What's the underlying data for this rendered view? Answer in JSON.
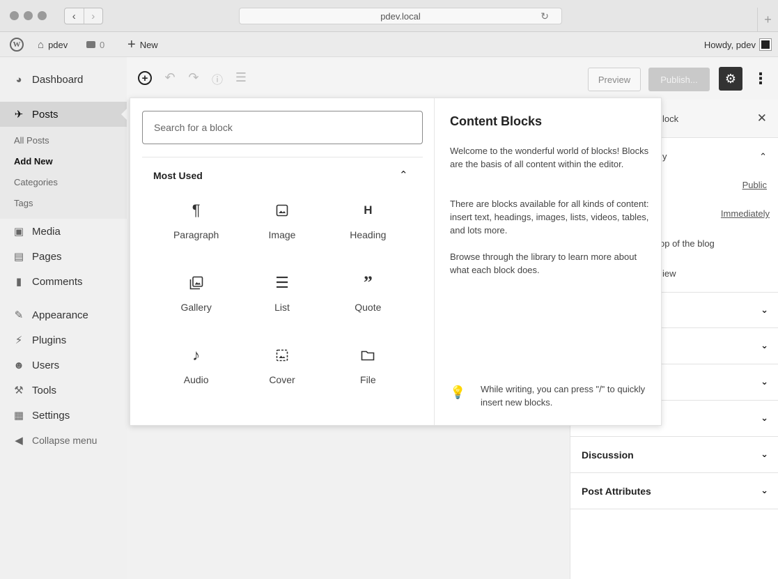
{
  "browser": {
    "url": "pdev.local",
    "back": "‹",
    "forward": "›",
    "new_tab": "+"
  },
  "admin_bar": {
    "site_name": "pdev",
    "comment_count": "0",
    "new_label": "New",
    "greeting": "Howdy, pdev"
  },
  "sidebar": {
    "items": [
      {
        "label": "Dashboard",
        "icon": "dashboard-icon"
      },
      {
        "label": "Posts",
        "icon": "pin-icon"
      },
      {
        "label": "Media",
        "icon": "media-icon"
      },
      {
        "label": "Pages",
        "icon": "pages-icon"
      },
      {
        "label": "Comments",
        "icon": "comments-icon"
      },
      {
        "label": "Appearance",
        "icon": "appearance-icon"
      },
      {
        "label": "Plugins",
        "icon": "plugins-icon"
      },
      {
        "label": "Users",
        "icon": "users-icon"
      },
      {
        "label": "Tools",
        "icon": "tools-icon"
      },
      {
        "label": "Settings",
        "icon": "settings-icon"
      },
      {
        "label": "Collapse menu",
        "icon": "collapse-icon"
      }
    ],
    "submenu": [
      "All Posts",
      "Add New",
      "Categories",
      "Tags"
    ]
  },
  "toolbar": {
    "preview": "Preview",
    "publish": "Publish..."
  },
  "inserter": {
    "search_placeholder": "Search for a block",
    "section_title": "Most Used",
    "blocks": [
      {
        "label": "Paragraph",
        "icon": "paragraph-icon"
      },
      {
        "label": "Image",
        "icon": "image-icon"
      },
      {
        "label": "Heading",
        "icon": "heading-icon"
      },
      {
        "label": "Gallery",
        "icon": "gallery-icon"
      },
      {
        "label": "List",
        "icon": "list-icon"
      },
      {
        "label": "Quote",
        "icon": "quote-icon"
      },
      {
        "label": "Audio",
        "icon": "audio-icon"
      },
      {
        "label": "Cover",
        "icon": "cover-icon"
      },
      {
        "label": "File",
        "icon": "file-icon"
      }
    ],
    "help": {
      "title": "Content Blocks",
      "p1": "Welcome to the wonderful world of blocks! Blocks are the basis of all content within the editor.",
      "p2": "There are blocks available for all kinds of content: insert text, headings, images, lists, videos, tables, and lots more.",
      "p3": "Browse through the library to learn more about what each block does.",
      "tip": "While writing, you can press \"/\" to quickly insert new blocks."
    }
  },
  "settings_panel": {
    "tab_partial": "lock",
    "status_partial": "y",
    "visibility_value": "Public",
    "publish_value": "Immediately",
    "sticky_partial": "op of the blog",
    "review_partial": "iew",
    "sections": [
      "Discussion",
      "Post Attributes"
    ]
  }
}
